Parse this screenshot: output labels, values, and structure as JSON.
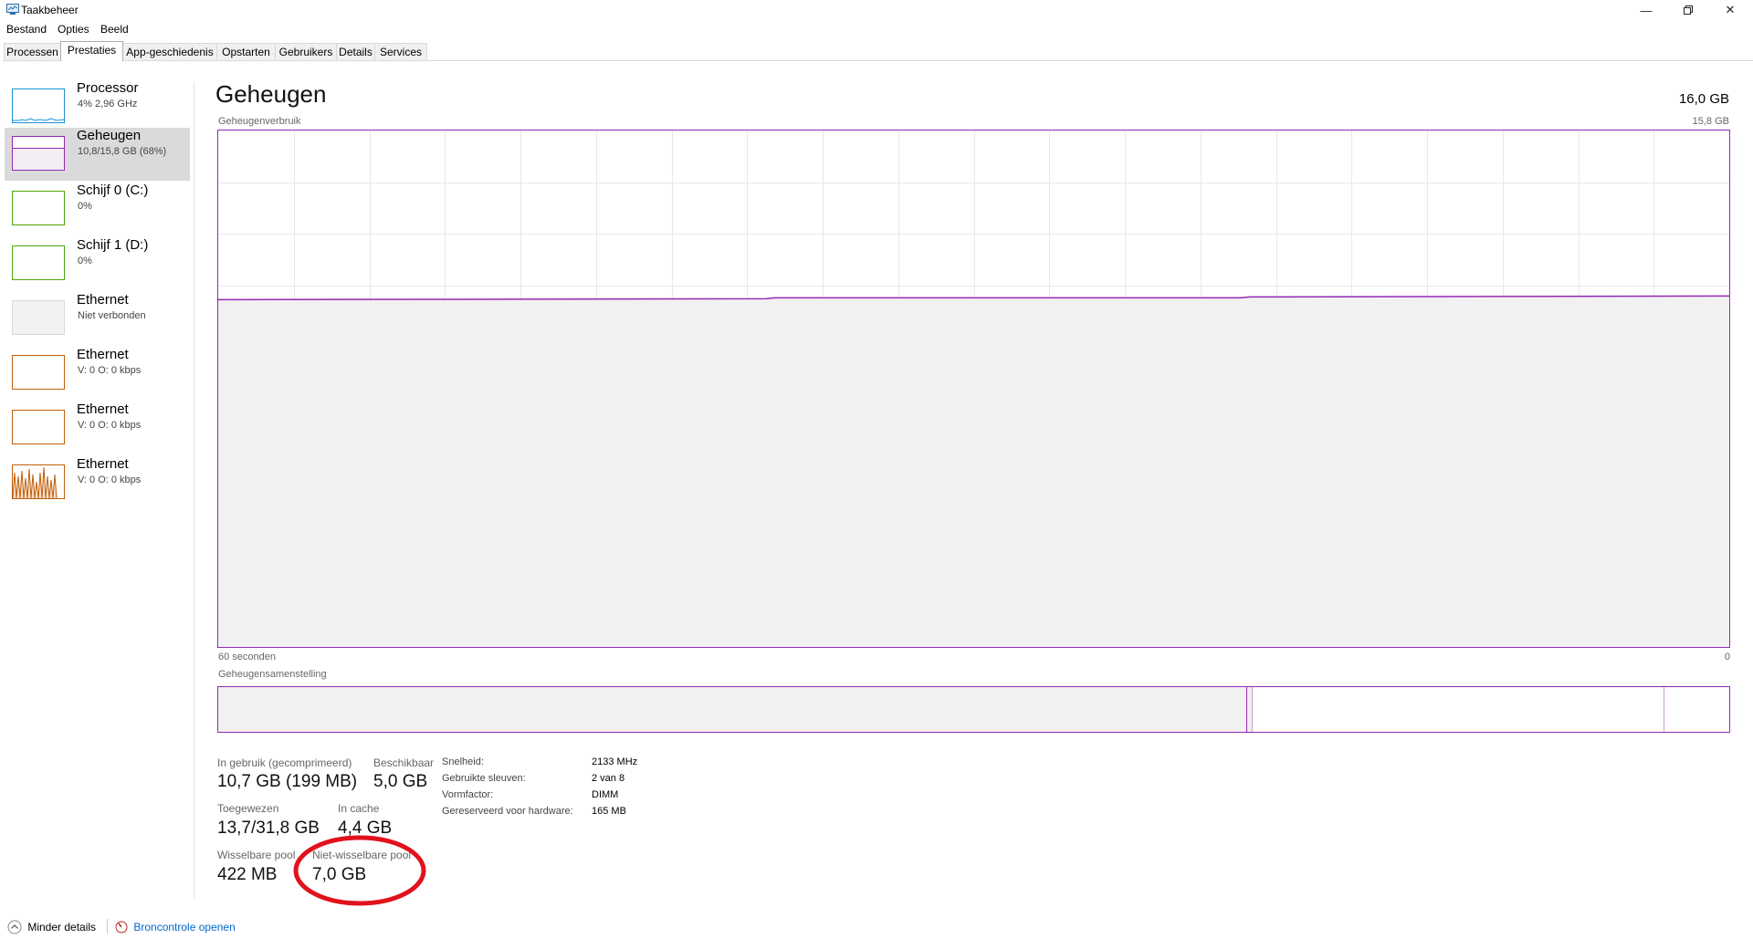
{
  "window": {
    "title": "Taakbeheer"
  },
  "menu": [
    "Bestand",
    "Opties",
    "Beeld"
  ],
  "tabs": [
    "Processen",
    "Prestaties",
    "App-geschiedenis",
    "Opstarten",
    "Gebruikers",
    "Details",
    "Services"
  ],
  "active_tab": "Prestaties",
  "sidebar": {
    "items": [
      {
        "name": "Processor",
        "sub": "4% 2,96 GHz",
        "color": "#1a8fd1"
      },
      {
        "name": "Geheugen",
        "sub": "10,8/15,8 GB (68%)",
        "color": "#9528b4",
        "selected": true
      },
      {
        "name": "Schijf 0 (C:)",
        "sub": "0%",
        "color": "#4da60c"
      },
      {
        "name": "Schijf 1 (D:)",
        "sub": "0%",
        "color": "#4da60c"
      },
      {
        "name": "Ethernet",
        "sub": "Niet verbonden",
        "color": "#cccccc"
      },
      {
        "name": "Ethernet",
        "sub": "V: 0 O: 0 kbps",
        "color": "#c15e0a"
      },
      {
        "name": "Ethernet",
        "sub": "V: 0 O: 0 kbps",
        "color": "#c15e0a"
      },
      {
        "name": "Ethernet",
        "sub": "V: 0 O: 0 kbps",
        "color": "#c15e0a"
      }
    ]
  },
  "main": {
    "title": "Geheugen",
    "total": "16,0 GB",
    "graph_label": "Geheugenverbruik",
    "graph_max": "15,8 GB",
    "time_label": "60 seconden",
    "time_end": "0",
    "composition_label": "Geheugensamenstelling",
    "usage_level": 0.676
  },
  "stats": {
    "in_use_label": "In gebruik (gecomprimeerd)",
    "in_use_value": "10,7 GB (199 MB)",
    "available_label": "Beschikbaar",
    "available_value": "5,0 GB",
    "committed_label": "Toegewezen",
    "committed_value": "13,7/31,8 GB",
    "cached_label": "In cache",
    "cached_value": "4,4 GB",
    "paged_label": "Wisselbare pool",
    "paged_value": "422 MB",
    "nonpaged_label": "Niet-wisselbare pool",
    "nonpaged_value": "7,0 GB"
  },
  "specs": [
    {
      "label": "Snelheid:",
      "value": "2133 MHz"
    },
    {
      "label": "Gebruikte sleuven:",
      "value": "2 van 8"
    },
    {
      "label": "Vormfactor:",
      "value": "DIMM"
    },
    {
      "label": "Gereserveerd voor hardware:",
      "value": "165 MB"
    }
  ],
  "footer": {
    "less_details": "Minder details",
    "resource_monitor": "Broncontrole openen"
  },
  "colors": {
    "memory": "#9528b4",
    "annotation": "#e0121c",
    "link": "#0066cc"
  }
}
